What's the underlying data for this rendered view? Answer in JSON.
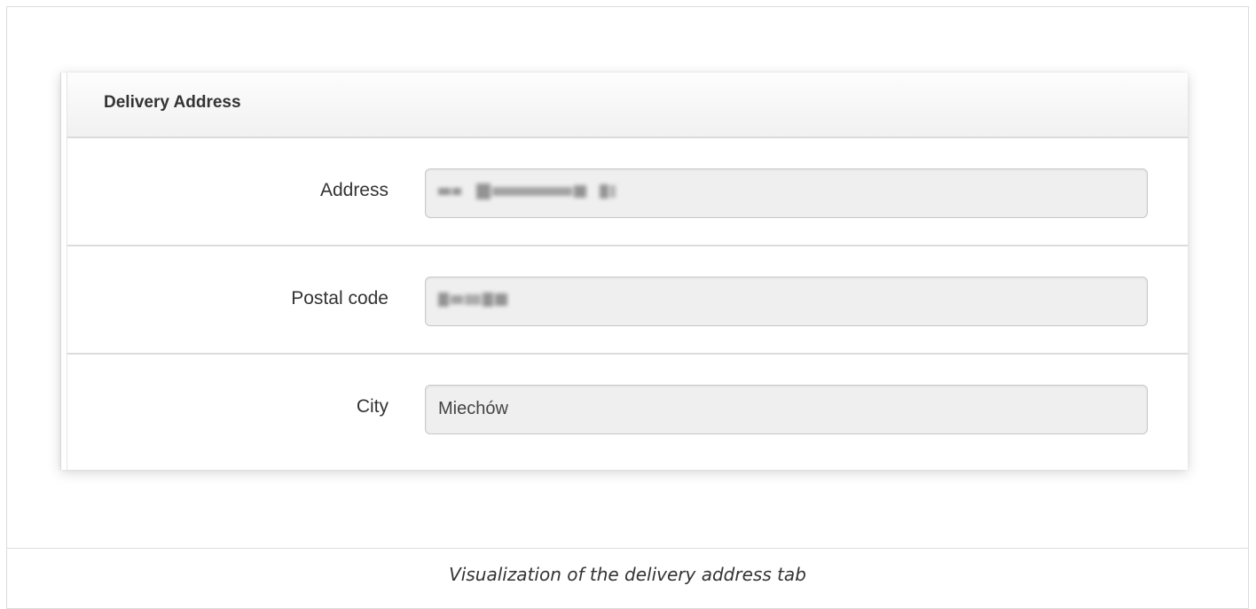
{
  "card": {
    "title": "Delivery Address"
  },
  "fields": [
    {
      "label": "Address",
      "value": "",
      "obscured": true
    },
    {
      "label": "Postal code",
      "value": "",
      "obscured": true
    },
    {
      "label": "City",
      "value": "Miechów",
      "obscured": false
    }
  ],
  "caption": "Visualization of the delivery address tab",
  "colors": {
    "input_background": "#efefef",
    "input_border": "#c8c8c8",
    "text": "#333333",
    "divider": "#dcdcdc"
  }
}
